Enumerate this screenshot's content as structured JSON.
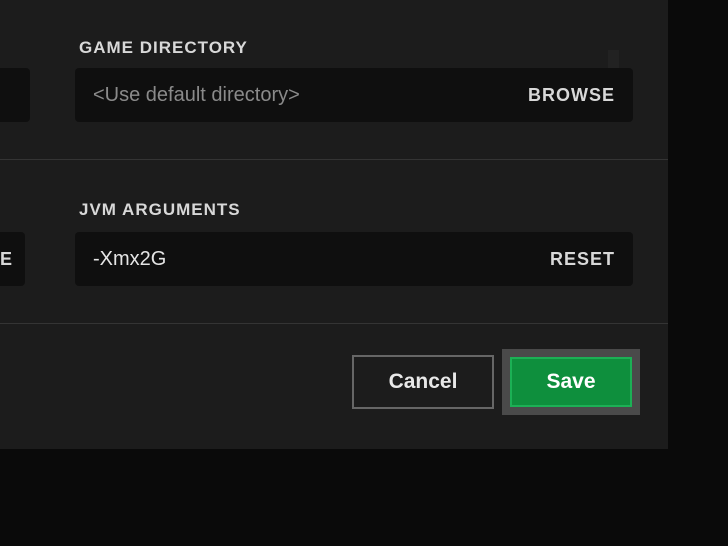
{
  "sections": {
    "gameDirectory": {
      "label": "GAME DIRECTORY",
      "placeholder": "<Use default directory>",
      "value": "",
      "action": "BROWSE"
    },
    "jvmArguments": {
      "label": "JVM ARGUMENTS",
      "value": "-Xmx2G",
      "action": "RESET"
    }
  },
  "cutoff": {
    "partial": "SE"
  },
  "buttons": {
    "cancel": "Cancel",
    "save": "Save"
  }
}
